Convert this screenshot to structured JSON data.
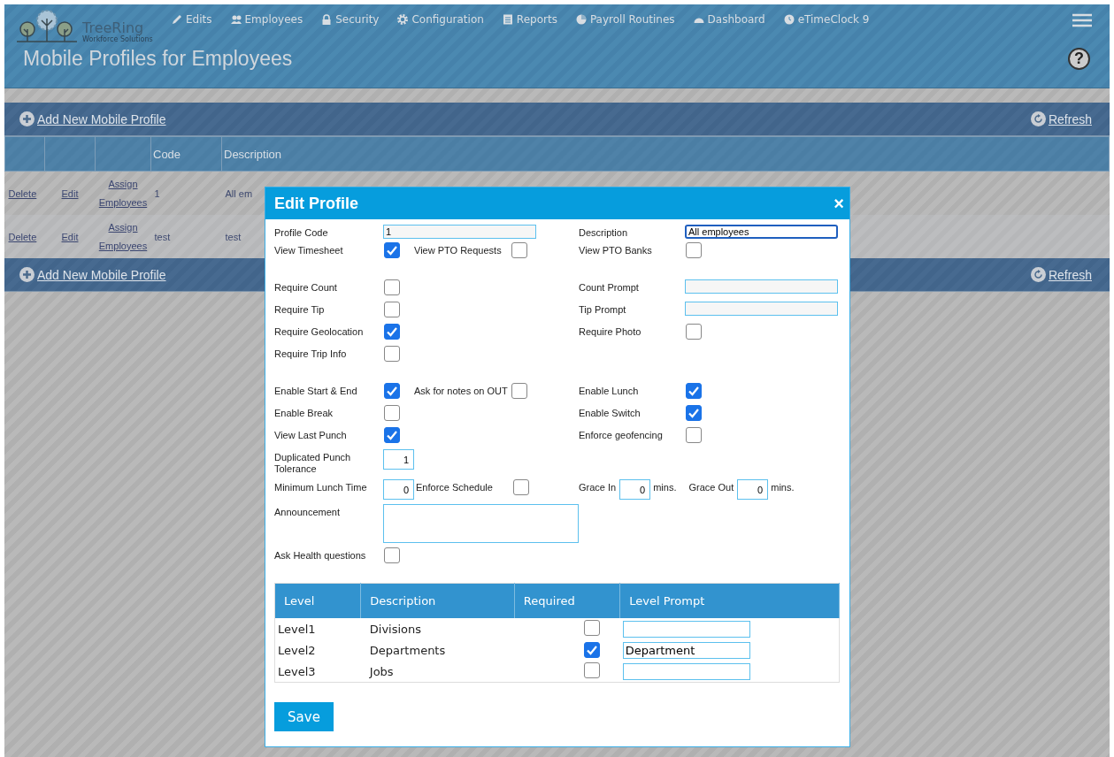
{
  "header": {
    "brand": {
      "name": "TreeRing",
      "tagline": "Workforce Solutions"
    },
    "nav": [
      {
        "label": "Edits",
        "kind": "pencil"
      },
      {
        "label": "Employees",
        "kind": "people"
      },
      {
        "label": "Security",
        "kind": "lock"
      },
      {
        "label": "Configuration",
        "kind": "gear"
      },
      {
        "label": "Reports",
        "kind": "document"
      },
      {
        "label": "Payroll Routines",
        "kind": "pie"
      },
      {
        "label": "Dashboard",
        "kind": "gauge"
      },
      {
        "label": "eTimeClock 9",
        "kind": "clock"
      }
    ],
    "title": "Mobile Profiles for Employees",
    "help": "?"
  },
  "toolbar_top": {
    "add": "Add New Mobile Profile",
    "refresh": "Refresh"
  },
  "table": {
    "columns": [
      "Code",
      "Description"
    ],
    "rows": [
      {
        "delete": "Delete",
        "edit": "Edit",
        "assign": "Assign Employees",
        "code": "1",
        "description": "All em"
      },
      {
        "delete": "Delete",
        "edit": "Edit",
        "assign": "Assign Employees",
        "code": "test",
        "description": "test"
      }
    ]
  },
  "toolbar_bottom": {
    "add": "Add New Mobile Profile",
    "refresh": "Refresh"
  },
  "dialog": {
    "title": "Edit Profile",
    "close": "×",
    "sections": [
      [
        {
          "left": [
            {
              "label": "Profile Code",
              "kind": "text",
              "value": "1",
              "focused": false
            }
          ],
          "right": [
            {
              "label": "Description",
              "kind": "text",
              "value": "All employees",
              "focused": true
            }
          ]
        },
        {
          "left": [
            {
              "label": "View Timesheet",
              "kind": "checkbox",
              "checked": true
            },
            {
              "label": "View PTO Requests",
              "kind": "checkbox",
              "checked": false
            }
          ],
          "right": [
            {
              "label": "View PTO Banks",
              "kind": "checkbox",
              "checked": false
            }
          ]
        }
      ],
      [
        {
          "left": [
            {
              "label": "Require Count",
              "kind": "checkbox",
              "checked": false
            }
          ],
          "right": [
            {
              "label": "Count Prompt",
              "kind": "text",
              "focused": false
            }
          ]
        },
        {
          "left": [
            {
              "label": "Require Tip",
              "kind": "checkbox",
              "checked": false
            }
          ],
          "right": [
            {
              "label": "Tip Prompt",
              "kind": "text",
              "focused": false
            }
          ]
        },
        {
          "left": [
            {
              "label": "Require Geolocation",
              "kind": "checkbox",
              "checked": true
            }
          ],
          "right": [
            {
              "label": "Require Photo",
              "kind": "checkbox",
              "checked": false
            }
          ]
        },
        {
          "left": [
            {
              "label": "Require Trip Info",
              "kind": "checkbox",
              "checked": false
            }
          ]
        }
      ],
      [
        {
          "left": [
            {
              "label": "Enable Start & End",
              "kind": "checkbox",
              "checked": true
            },
            {
              "label": "Ask for notes on OUT",
              "kind": "checkbox",
              "checked": false
            }
          ],
          "right": [
            {
              "label": "Enable Lunch",
              "kind": "checkbox",
              "checked": true
            }
          ]
        },
        {
          "left": [
            {
              "label": "Enable Break",
              "kind": "checkbox",
              "checked": false
            }
          ],
          "right": [
            {
              "label": "Enable Switch",
              "kind": "checkbox",
              "checked": true
            }
          ]
        },
        {
          "left": [
            {
              "label": "View Last Punch",
              "kind": "checkbox",
              "checked": true
            }
          ],
          "right": [
            {
              "label": "Enforce geofencing",
              "kind": "checkbox",
              "checked": false
            }
          ]
        },
        {
          "left": [
            {
              "label": "Duplicated Punch Tolerance",
              "kind": "number",
              "value": "1"
            }
          ]
        },
        {
          "left": [
            {
              "label": "Minimum Lunch Time",
              "kind": "number",
              "value": "0"
            },
            {
              "label": "Enforce Schedule",
              "kind": "checkbox",
              "checked": false
            }
          ],
          "right": [
            {
              "label": "Grace In",
              "kind": "number",
              "value": "0",
              "suffix": "mins."
            },
            {
              "label": "Grace Out",
              "kind": "number",
              "value": "0",
              "suffix": "mins."
            }
          ]
        },
        {
          "left": [
            {
              "label": "Announcement",
              "kind": "textarea"
            }
          ]
        },
        {
          "left": [
            {
              "label": "Ask Health questions",
              "kind": "checkbox",
              "checked": false
            }
          ]
        }
      ]
    ],
    "levels": {
      "columns": [
        "Level",
        "Description",
        "Required",
        "Level Prompt"
      ],
      "rows": [
        {
          "level": "Level1",
          "description": "Divisions",
          "required": false
        },
        {
          "level": "Level2",
          "description": "Departments",
          "required": true,
          "prompt": "Department"
        },
        {
          "level": "Level3",
          "description": "Jobs",
          "required": false
        }
      ]
    },
    "save": "Save"
  }
}
